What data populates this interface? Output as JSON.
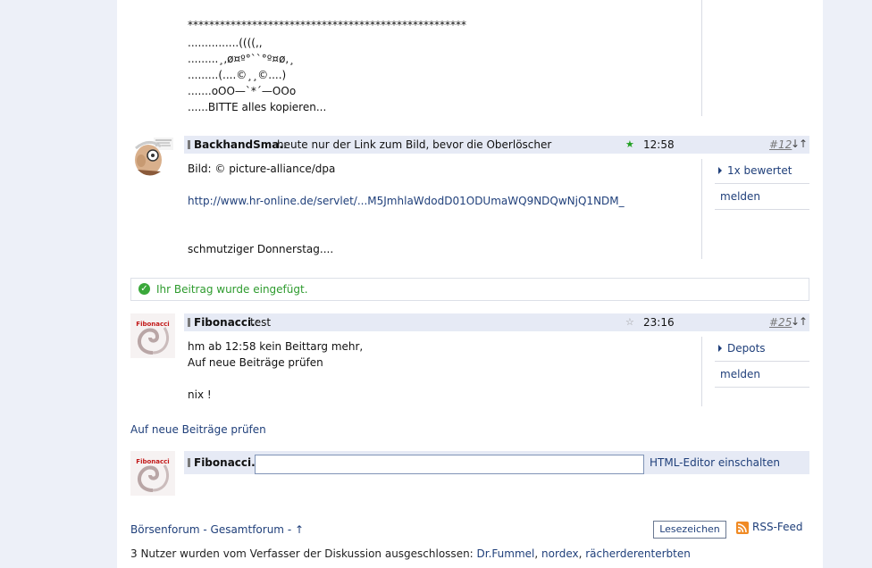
{
  "post_prev": {
    "lines": [
      "****************************************************",
      "...............((((,,",
      ".........¸,ø¤º°``°º¤ø,¸",
      ".........(....©¸¸©....)",
      ".......oOO—`*´—OOo",
      "......BITTE alles kopieren..."
    ]
  },
  "post_12": {
    "user": "BackhandSma.",
    "sep": ":",
    "title": "heute nur der Link zum Bild, bevor die Oberlöscher",
    "star": "★",
    "time": "12:58",
    "number": "#12",
    "arrows": "↓↑",
    "body": [
      "Bild: © picture-alliance/dpa",
      "",
      "schmutziger Donnerstag...."
    ],
    "link": "http://www.hr-online.de/servlet/...M5JmhlaWdodD01ODUmaWQ9NDQwNjQ1NDM_",
    "side": [
      "1x bewertet",
      "melden"
    ]
  },
  "notice": "Ihr Beitrag wurde eingefügt.",
  "post_25": {
    "user": "Fibonacci.",
    "sep": ":",
    "title": "test",
    "star": "☆",
    "time": "23:16",
    "number": "#25",
    "arrows": "↓↑",
    "body": [
      "hm ab 12:58 kein Beittarg mehr,",
      "Auf neue Beiträge prüfen",
      "nix !"
    ],
    "side": [
      "Depots",
      "melden"
    ]
  },
  "check_new": "Auf neue Beiträge prüfen",
  "reply": {
    "user": "Fibonacci.",
    "sep": ":",
    "input_value": "",
    "editor_link": "HTML-Editor einschalten"
  },
  "footer": {
    "breadcrumb": [
      "Börsenforum",
      "Gesamtforum"
    ],
    "bc_sep": " - ",
    "up": "↑",
    "bookmark": "Lesezeichen",
    "rss": "RSS-Feed",
    "excluded_prefix": "3 Nutzer wurden vom Verfasser der Diskussion ausgeschlossen: ",
    "excluded_users": [
      "Dr.Fummel",
      "nordex",
      "rächerderenterbten"
    ],
    "comma": ", "
  },
  "avatar_label": "Fibonacci",
  "colors": {
    "link": "#1f3f7a",
    "header": "#e6eaf5",
    "success": "#2e9b2e",
    "star_active": "#22a022"
  }
}
